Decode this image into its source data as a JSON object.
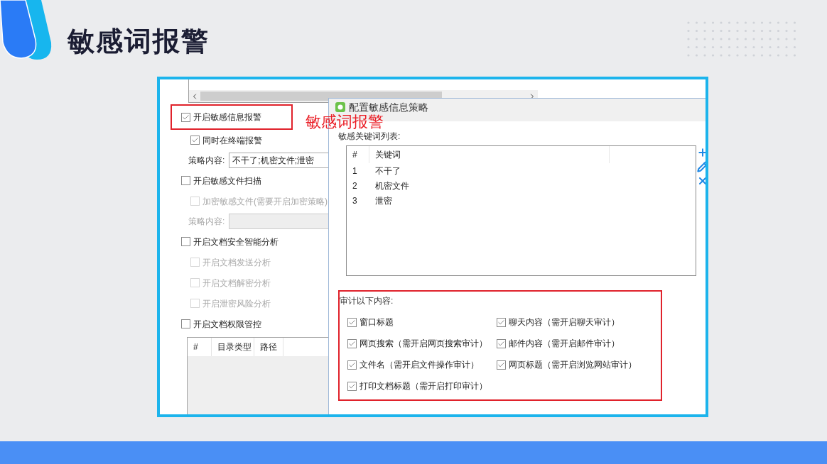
{
  "slide": {
    "title": "敏感词报警"
  },
  "annotation": {
    "text": "敏感词报警"
  },
  "panel": {
    "options": [
      {
        "kind": "checkbox",
        "label": "开启敏感信息报警",
        "checked": true,
        "disabled": false,
        "highlighted": true,
        "children": [
          {
            "kind": "checkbox",
            "label": "同时在终端报警",
            "checked": true,
            "disabled": false
          },
          {
            "kind": "field",
            "label": "策略内容:",
            "value": "不干了;机密文件;泄密",
            "disabled": false
          }
        ]
      },
      {
        "kind": "checkbox",
        "label": "开启敏感文件扫描",
        "checked": false,
        "disabled": false,
        "highlighted": false,
        "children": [
          {
            "kind": "checkbox",
            "label": "加密敏感文件(需要开启加密策略)",
            "checked": false,
            "disabled": true
          },
          {
            "kind": "field",
            "label": "策略内容:",
            "disabled": true
          }
        ]
      },
      {
        "kind": "checkbox",
        "label": "开启文档安全智能分析",
        "checked": false,
        "disabled": false,
        "highlighted": false,
        "children": [
          {
            "kind": "checkbox",
            "label": "开启文档发送分析",
            "checked": false,
            "disabled": true
          },
          {
            "kind": "checkbox",
            "label": "开启文档解密分析",
            "checked": false,
            "disabled": true
          },
          {
            "kind": "checkbox",
            "label": "开启泄密风险分析",
            "checked": false,
            "disabled": true
          }
        ]
      },
      {
        "kind": "checkbox",
        "label": "开启文档权限管控",
        "checked": false,
        "disabled": false,
        "highlighted": false,
        "children": [
          {
            "kind": "table",
            "columns": [
              "#",
              "目录类型",
              "路径"
            ]
          }
        ]
      }
    ]
  },
  "dialog": {
    "title": "配置敏感信息策略",
    "keyword_list": {
      "label": "敏感关键词列表:",
      "columns": [
        "#",
        "关键词"
      ],
      "rows": [
        {
          "index": "1",
          "keyword": "不干了"
        },
        {
          "index": "2",
          "keyword": "机密文件"
        },
        {
          "index": "3",
          "keyword": "泄密"
        }
      ]
    },
    "audit": {
      "label": "审计以下内容:",
      "highlighted": true,
      "items": [
        {
          "label": "窗口标题",
          "checked": true
        },
        {
          "label": "聊天内容（需开启聊天审计）",
          "checked": true
        },
        {
          "label": "网页搜索（需开启网页搜索审计）",
          "checked": true
        },
        {
          "label": "邮件内容（需开启邮件审计）",
          "checked": true
        },
        {
          "label": "文件名（需开启文件操作审计）",
          "checked": true
        },
        {
          "label": "网页标题（需开启浏览网站审计）",
          "checked": true
        },
        {
          "label": "打印文档标题（需开启打印审计）",
          "checked": true
        }
      ]
    }
  }
}
